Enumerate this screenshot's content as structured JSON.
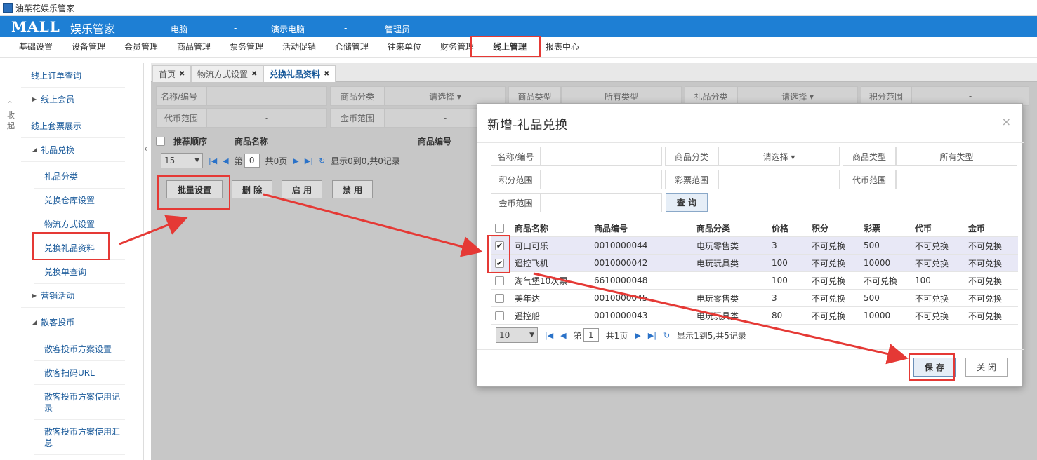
{
  "window_title": "油菜花娱乐管家",
  "header": {
    "logo": "MALL",
    "logo_sub": "娱乐管家",
    "info": [
      "电脑",
      "-",
      "演示电脑",
      "-",
      "管理员"
    ]
  },
  "menu": [
    "基础设置",
    "设备管理",
    "会员管理",
    "商品管理",
    "票务管理",
    "活动促销",
    "仓储管理",
    "往来单位",
    "财务管理",
    "线上管理",
    "报表中心"
  ],
  "menu_active": "线上管理",
  "sidebar": {
    "collapse_label": "收起",
    "items": [
      {
        "label": "线上订单查询",
        "level": 1,
        "tri": ""
      },
      {
        "label": "线上会员",
        "level": 1,
        "tri": "▶"
      },
      {
        "label": "线上套票展示",
        "level": 1,
        "tri": ""
      },
      {
        "label": "礼品兑换",
        "level": 1,
        "tri": "◢"
      },
      {
        "label": "礼品分类",
        "level": 2,
        "tri": ""
      },
      {
        "label": "兑换仓库设置",
        "level": 2,
        "tri": ""
      },
      {
        "label": "物流方式设置",
        "level": 2,
        "tri": ""
      },
      {
        "label": "兑换礼品资料",
        "level": 2,
        "tri": ""
      },
      {
        "label": "兑换单查询",
        "level": 2,
        "tri": ""
      },
      {
        "label": "营销活动",
        "level": 1,
        "tri": "▶"
      },
      {
        "label": "散客投币",
        "level": 1,
        "tri": "◢"
      },
      {
        "label": "散客投币方案设置",
        "level": 2,
        "tri": ""
      },
      {
        "label": "散客扫码URL",
        "level": 2,
        "tri": ""
      },
      {
        "label": "散客投币方案使用记录",
        "level": 2,
        "tri": ""
      },
      {
        "label": "散客投币方案使用汇总",
        "level": 2,
        "tri": ""
      }
    ]
  },
  "tabs": [
    {
      "label": "首页",
      "active": false
    },
    {
      "label": "物流方式设置",
      "active": false
    },
    {
      "label": "兑换礼品资料",
      "active": true
    }
  ],
  "filters": {
    "row1": [
      {
        "label": "名称/编号",
        "value": ""
      },
      {
        "label": "商品分类",
        "value": "请选择 ▾"
      },
      {
        "label": "商品类型",
        "value": "所有类型"
      },
      {
        "label": "礼品分类",
        "value": "请选择 ▾"
      },
      {
        "label": "积分范围",
        "value": "-"
      }
    ],
    "row2": [
      {
        "label": "代币范围",
        "value": "-"
      },
      {
        "label": "金币范围",
        "value": "-"
      }
    ]
  },
  "grid": {
    "headers": [
      "推荐顺序",
      "商品名称",
      "商品编号"
    ],
    "page_size": "15",
    "page_label_pre": "第",
    "page_no": "0",
    "page_label_post": "共0页",
    "record_info": "显示0到0,共0记录"
  },
  "buttons": {
    "batch": "批量设置",
    "delete": "删 除",
    "enable": "启 用",
    "disable": "禁 用"
  },
  "modal": {
    "title": "新增-礼品兑换",
    "close_icon": "×",
    "filters": [
      [
        {
          "label": "名称/编号",
          "value": ""
        },
        {
          "label": "商品分类",
          "value": "请选择 ▾"
        },
        {
          "label": "商品类型",
          "value": "所有类型"
        }
      ],
      [
        {
          "label": "积分范围",
          "value": "-"
        },
        {
          "label": "彩票范围",
          "value": "-"
        },
        {
          "label": "代币范围",
          "value": "-"
        }
      ],
      [
        {
          "label": "金币范围",
          "value": "-"
        }
      ]
    ],
    "query_label": "查 询",
    "columns": [
      "商品名称",
      "商品编号",
      "商品分类",
      "价格",
      "积分",
      "彩票",
      "代币",
      "金币"
    ],
    "rows": [
      {
        "checked": true,
        "cells": [
          "可口可乐",
          "0010000044",
          "电玩零售类",
          "3",
          "不可兑换",
          "500",
          "不可兑换",
          "不可兑换"
        ]
      },
      {
        "checked": true,
        "cells": [
          "遥控飞机",
          "0010000042",
          "电玩玩具类",
          "100",
          "不可兑换",
          "10000",
          "不可兑换",
          "不可兑换"
        ]
      },
      {
        "checked": false,
        "cells": [
          "淘气堡10次票",
          "6610000048",
          "",
          "100",
          "不可兑换",
          "不可兑换",
          "100",
          "不可兑换"
        ]
      },
      {
        "checked": false,
        "cells": [
          "美年达",
          "0010000045",
          "电玩零售类",
          "3",
          "不可兑换",
          "500",
          "不可兑换",
          "不可兑换"
        ]
      },
      {
        "checked": false,
        "cells": [
          "遥控船",
          "0010000043",
          "电玩玩具类",
          "80",
          "不可兑换",
          "10000",
          "不可兑换",
          "不可兑换"
        ]
      }
    ],
    "page_size": "10",
    "page_label_pre": "第",
    "page_no": "1",
    "page_label_post": "共1页",
    "record_info": "显示1到5,共5记录",
    "save_label": "保 存",
    "close_label": "关 闭"
  },
  "colors": {
    "brand": "#1e7fd4",
    "highlight": "#e53935"
  }
}
